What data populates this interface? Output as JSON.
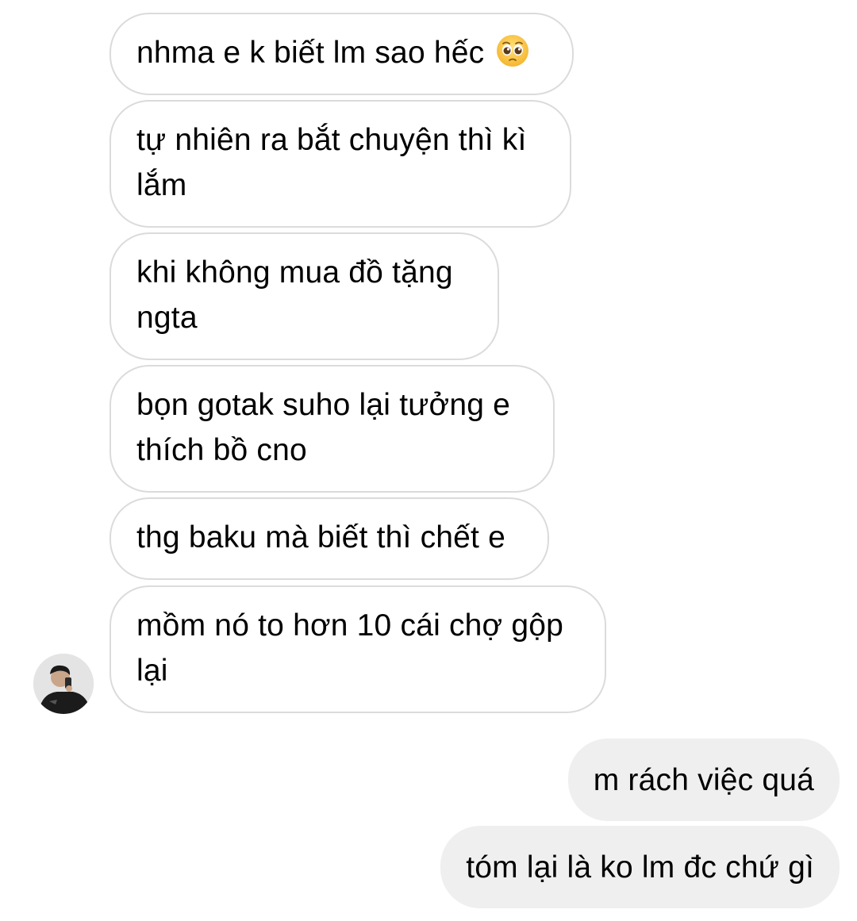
{
  "messages": [
    {
      "from": "other",
      "text": "nhma e k biết lm sao hếc",
      "emoji": "pleading-face-emoji"
    },
    {
      "from": "other",
      "text": "tự nhiên ra bắt chuyện thì kì lắm"
    },
    {
      "from": "other",
      "text": "khi không mua đồ tặng ngta"
    },
    {
      "from": "other",
      "text": "bọn gotak suho lại tưởng e thích bồ cno"
    },
    {
      "from": "other",
      "text": "thg baku mà biết thì chết e"
    },
    {
      "from": "other",
      "text": "mồm nó to hơn 10 cái chợ gộp lại"
    },
    {
      "from": "me",
      "text": "m rách việc quá"
    },
    {
      "from": "me",
      "text": "tóm lại là ko lm đc chứ gì"
    }
  ],
  "colors": {
    "incoming_bg": "#ffffff",
    "incoming_border": "#dbdbdb",
    "outgoing_bg": "#efefef",
    "text": "#000000"
  },
  "avatar": {
    "icon": "user-avatar"
  }
}
